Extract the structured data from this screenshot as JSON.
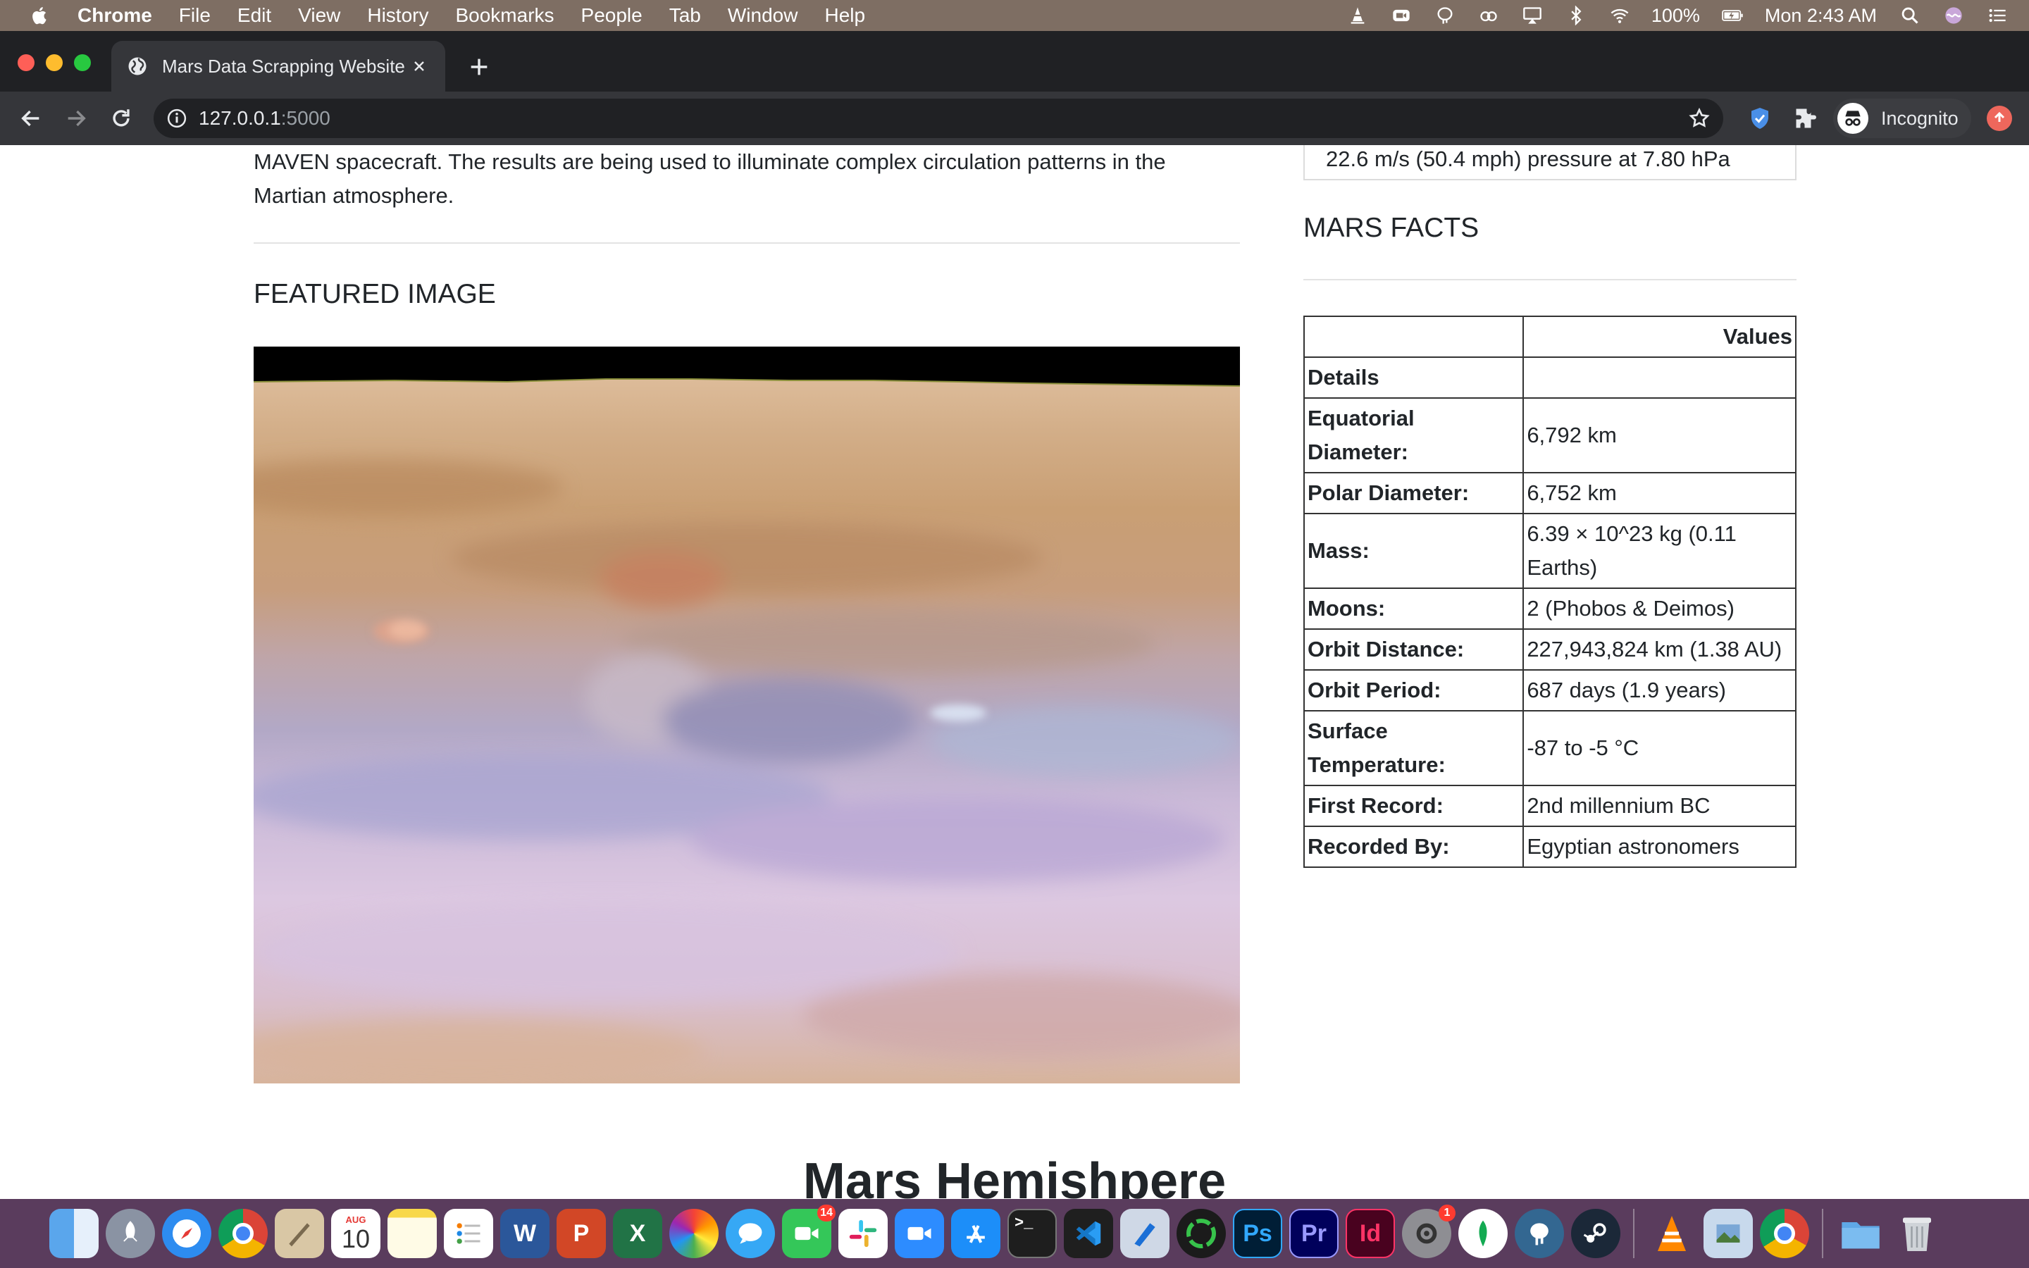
{
  "menubar": {
    "items": [
      "Chrome",
      "File",
      "Edit",
      "View",
      "History",
      "Bookmarks",
      "People",
      "Tab",
      "Window",
      "Help"
    ],
    "battery": "100%",
    "clock": "Mon 2:43 AM"
  },
  "browser": {
    "tab_title": "Mars Data Scrapping Website",
    "url_host": "127.0.0.1",
    "url_port": ":5000",
    "incognito_label": "Incognito"
  },
  "page": {
    "intro_text": "MAVEN spacecraft. The results are being used to illuminate complex circulation patterns in the Martian atmosphere.",
    "weather_partial": "22.6 m/s (50.4 mph) pressure at 7.80 hPa",
    "featured_heading": "FEATURED IMAGE",
    "facts_heading": "MARS FACTS",
    "hemisphere_heading": "Mars Hemishpere",
    "facts_table": {
      "header_left": "",
      "header_right": "Values",
      "rows": [
        {
          "key": "Details",
          "value": ""
        },
        {
          "key": "Equatorial Diameter:",
          "value": "6,792 km"
        },
        {
          "key": "Polar Diameter:",
          "value": "6,752 km"
        },
        {
          "key": "Mass:",
          "value": "6.39 × 10^23 kg (0.11 Earths)"
        },
        {
          "key": "Moons:",
          "value": "2 (Phobos & Deimos)"
        },
        {
          "key": "Orbit Distance:",
          "value": "227,943,824 km (1.38 AU)"
        },
        {
          "key": "Orbit Period:",
          "value": "687 days (1.9 years)"
        },
        {
          "key": "Surface Temperature:",
          "value": "-87 to -5 °C"
        },
        {
          "key": "First Record:",
          "value": "2nd millennium BC"
        },
        {
          "key": "Recorded By:",
          "value": "Egyptian astronomers"
        }
      ]
    }
  },
  "dock": {
    "calendar_month": "AUG",
    "calendar_day": "10",
    "facetime_badge": "14",
    "sysprefs_badge": "1"
  }
}
